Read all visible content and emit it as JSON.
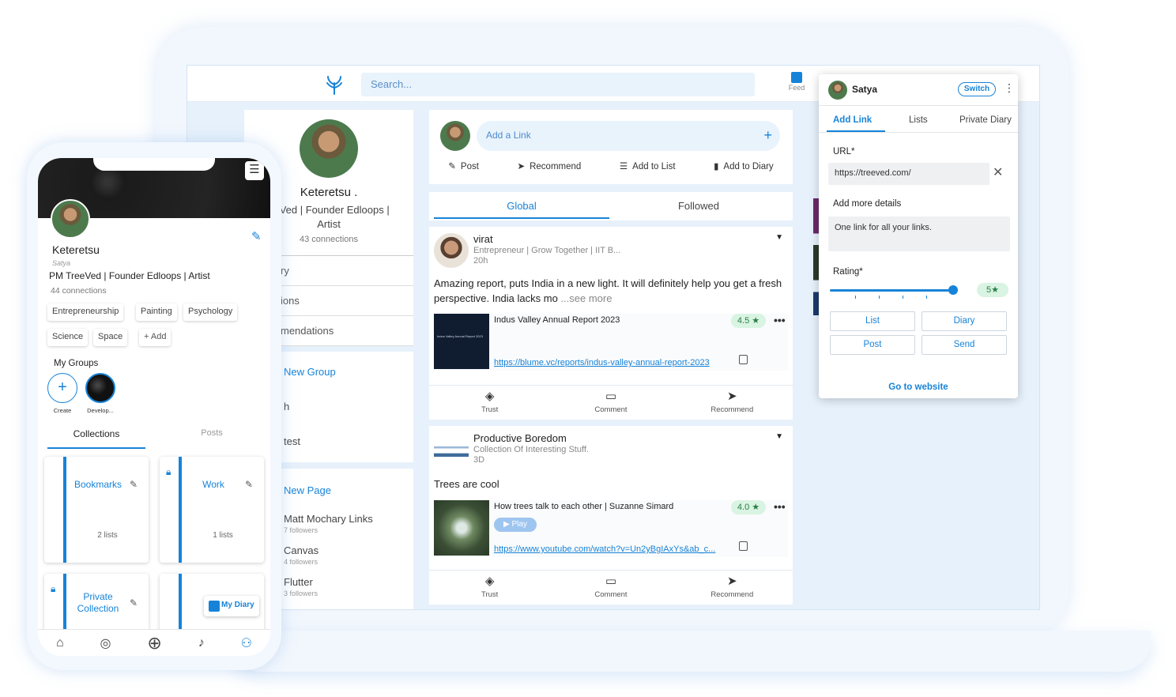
{
  "desktop": {
    "search_placeholder": "Search...",
    "nav_feed": "Feed",
    "profile": {
      "name": "Keteretsu .",
      "bio_line1": "eeVed | Founder Edloops |",
      "bio_line2": "Artist",
      "connections": "43 connections"
    },
    "left_menu": [
      "ry",
      "ions",
      "mendations"
    ],
    "groups": {
      "new_group": "New Group",
      "item1": "h",
      "item2": "test"
    },
    "pages": {
      "new_page": "New Page",
      "items": [
        {
          "name": "Matt Mochary Links",
          "followers": "7 followers"
        },
        {
          "name": "Canvas",
          "followers": "4 followers"
        },
        {
          "name": "Flutter",
          "followers": "3 followers"
        }
      ]
    },
    "composer": {
      "add_link": "Add a Link",
      "actions": [
        "Post",
        "Recommend",
        "Add to List",
        "Add to Diary"
      ]
    },
    "tabs": [
      "Global",
      "Followed"
    ],
    "posts": [
      {
        "author": "virat",
        "subtitle": "Entrepreneur | Grow Together | IIT B...",
        "time": "20h",
        "body": "Amazing report, puts India in a new light. It will definitely help you get a fresh perspective. India lacks mo",
        "see_more": " ...see more",
        "link_title": "Indus Valley Annual Report 2023",
        "rating": "4.5 ★",
        "url": "https://blume.vc/reports/indus-valley-annual-report-2023",
        "thumb_text": "Indus Valley Annual Report 2023"
      },
      {
        "author": "Productive Boredom",
        "subtitle": "Collection Of Interesting Stuff.",
        "time": "3D",
        "body": "Trees are cool",
        "link_title": "How trees talk to each other | Suzanne Simard",
        "play": "▶ Play",
        "rating": "4.0 ★",
        "url": "https://www.youtube.com/watch?v=Un2yBgIAxYs&ab_c..."
      }
    ],
    "post_actions": [
      "Trust",
      "Comment",
      "Recommend"
    ]
  },
  "popup": {
    "user": "Satya",
    "switch": "Switch",
    "tabs": [
      "Add Link",
      "Lists",
      "Private Diary"
    ],
    "url_label": "URL*",
    "url_value": "https://treeved.com/",
    "details_label": "Add more details",
    "details_value": "One link for all your links.",
    "rating_label": "Rating*",
    "rating_value": 5,
    "rating_display": "5★",
    "buttons": [
      "List",
      "Diary",
      "Post",
      "Send"
    ],
    "go": "Go to website"
  },
  "phone": {
    "name": "Keteretsu",
    "username": "Satya",
    "bio": "PM TreeVed | Founder Edloops | Artist",
    "connections": "44 connections",
    "chips": [
      "Entrepreneurship",
      "Painting",
      "Psychology",
      "Science",
      "Space",
      "+ Add"
    ],
    "my_groups": "My Groups",
    "group_labels": [
      "Create",
      "Develop..."
    ],
    "tabs": [
      "Collections",
      "Posts"
    ],
    "collections": [
      {
        "title": "Bookmarks",
        "count": "2 lists"
      },
      {
        "title": "Work",
        "count": "1 lists"
      },
      {
        "title": "Private Collection",
        "count": ""
      },
      {
        "title": "",
        "count": ""
      }
    ],
    "my_diary": "My Diary"
  },
  "colors": {
    "accent": "#1783d8",
    "rating_bg": "#d9f4e2"
  }
}
